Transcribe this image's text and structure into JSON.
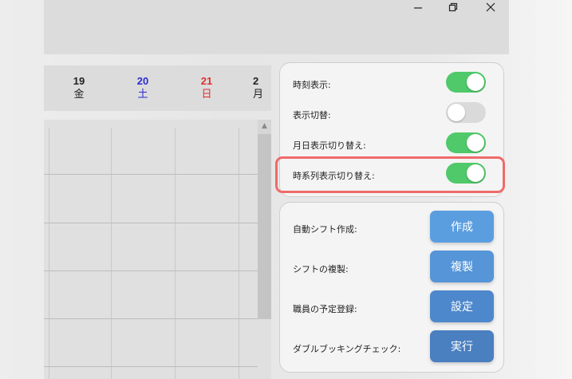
{
  "window": {
    "minimize_icon": "minimize-icon",
    "restore_icon": "restore-icon",
    "close_icon": "close-icon"
  },
  "calendar": {
    "days": [
      {
        "num": "19",
        "weekday": "金",
        "color": "#222222"
      },
      {
        "num": "20",
        "weekday": "土",
        "color": "#2b2bd4"
      },
      {
        "num": "21",
        "weekday": "日",
        "color": "#e03030"
      },
      {
        "num": "2",
        "weekday": "月",
        "color": "#222222"
      }
    ],
    "scroll_up_icon": "arrow-up-icon"
  },
  "display_settings": {
    "items": [
      {
        "label": "時刻表示:",
        "on": true
      },
      {
        "label": "表示切替:",
        "on": false
      },
      {
        "label": "月日表示切り替え:",
        "on": true
      },
      {
        "label": "時系列表示切り替え:",
        "on": true
      }
    ]
  },
  "actions": {
    "items": [
      {
        "label": "自動シフト作成:",
        "button": "作成",
        "color": "#5b9ee0"
      },
      {
        "label": "シフトの複製:",
        "button": "複製",
        "color": "#5595d8"
      },
      {
        "label": "職員の予定登録:",
        "button": "設定",
        "color": "#4e88cc"
      },
      {
        "label": "ダブルブッキングチェック:",
        "button": "実行",
        "color": "#4a7fc0"
      }
    ]
  },
  "colors": {
    "toggle_on": "#4fc96a",
    "toggle_off": "#dadada",
    "highlight": "#ef6a6a"
  }
}
